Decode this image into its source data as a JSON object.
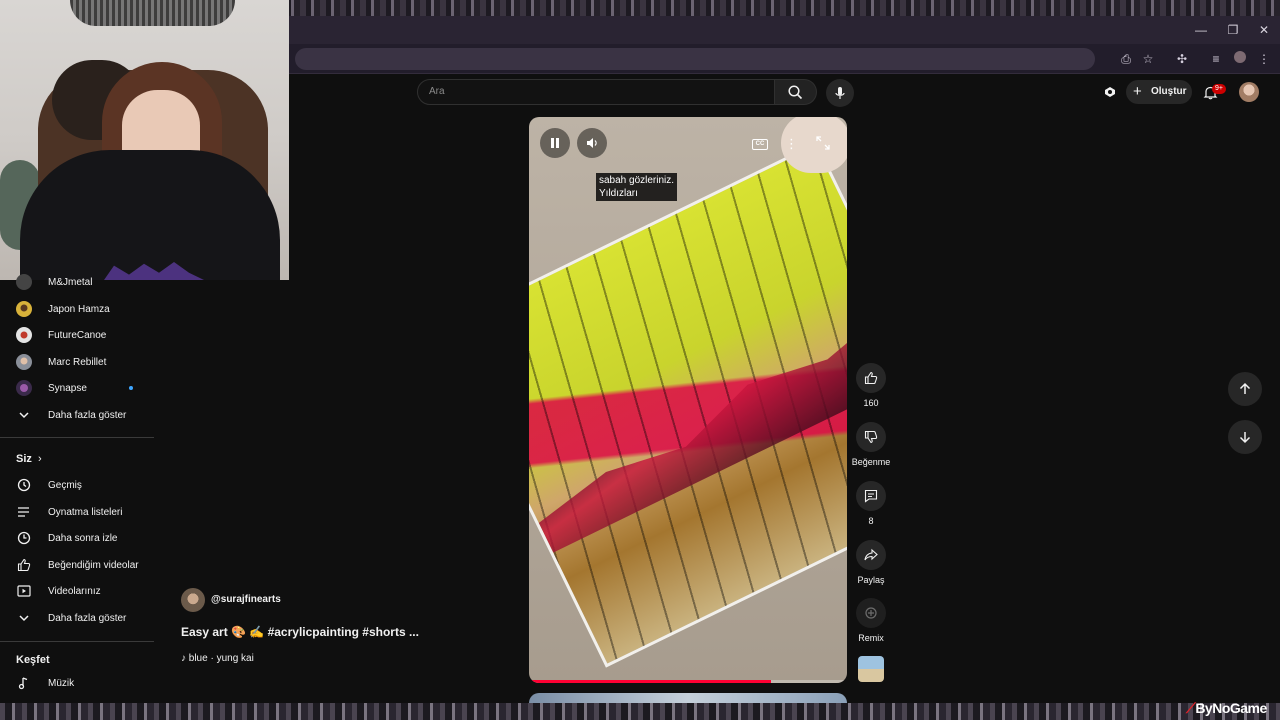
{
  "search": {
    "placeholder": "Ara"
  },
  "header": {
    "create_label": "Oluştur",
    "notif_count": "9+"
  },
  "sidebar": {
    "subscriptions": [
      {
        "label": "M&Jmetal"
      },
      {
        "label": "Japon Hamza"
      },
      {
        "label": "FutureCanoe"
      },
      {
        "label": "Marc Rebillet"
      },
      {
        "label": "Synapse"
      }
    ],
    "subs_more": "Daha fazla göster",
    "you_header": "Siz",
    "you_items": [
      {
        "label": "Geçmiş",
        "icon": "history-icon"
      },
      {
        "label": "Oynatma listeleri",
        "icon": "playlists-icon"
      },
      {
        "label": "Daha sonra izle",
        "icon": "watch-later-icon"
      },
      {
        "label": "Beğendiğim videolar",
        "icon": "like-icon"
      },
      {
        "label": "Videolarınız",
        "icon": "your-videos-icon"
      }
    ],
    "you_more": "Daha fazla göster",
    "explore_header": "Keşfet",
    "explore_items": [
      {
        "label": "Müzik",
        "icon": "music-icon"
      }
    ]
  },
  "video": {
    "caption_line1": "sabah gözleriniz.",
    "caption_line2": "Yıldızları",
    "cc_label": "CC",
    "progress": 0.76
  },
  "short": {
    "channel": "@surajfinearts",
    "title": "Easy art 🎨 ✍️ #acrylicpainting #shorts ...",
    "music": "♪ blue · yung kai"
  },
  "actions": {
    "likes": "160",
    "dislike_label": "Beğenme",
    "comments": "8",
    "share_label": "Paylaş",
    "remix_label": "Remix"
  },
  "watermark": {
    "text": "ByNoGame"
  },
  "colors": {
    "background": "#0f0f0f",
    "accent_red": "#ff0033",
    "text": "#f1f1f1"
  }
}
